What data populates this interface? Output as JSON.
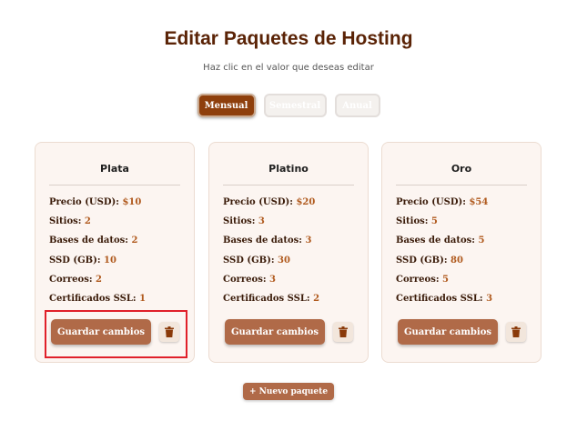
{
  "header": {
    "title": "Editar Paquetes de Hosting",
    "subtitle": "Haz clic en el valor que deseas editar"
  },
  "periods": [
    {
      "label": "Mensual",
      "active": true
    },
    {
      "label": "Semestral",
      "active": false
    },
    {
      "label": "Anual",
      "active": false
    }
  ],
  "labels": {
    "price": "Precio (USD): ",
    "sites": "Sitios: ",
    "databases": "Bases de datos: ",
    "ssd": "SSD (GB): ",
    "emails": "Correos: ",
    "ssl": "Certificados SSL: "
  },
  "packages": [
    {
      "name": "Plata",
      "price": "$10",
      "sites": "2",
      "databases": "2",
      "ssd": "10",
      "emails": "2",
      "ssl": "1"
    },
    {
      "name": "Platino",
      "price": "$20",
      "sites": "3",
      "databases": "3",
      "ssd": "30",
      "emails": "3",
      "ssl": "2"
    },
    {
      "name": "Oro",
      "price": "$54",
      "sites": "5",
      "databases": "5",
      "ssd": "80",
      "emails": "5",
      "ssl": "3"
    }
  ],
  "actions": {
    "save_label": "Guardar cambios",
    "new_package_label": "+ Nuevo paquete"
  },
  "colors": {
    "accent": "#b06a48",
    "active_tab": "#8e3f0c",
    "value_text": "#b05a1e",
    "highlight": "#e0202a"
  },
  "icons": {
    "delete": "trash-icon"
  }
}
